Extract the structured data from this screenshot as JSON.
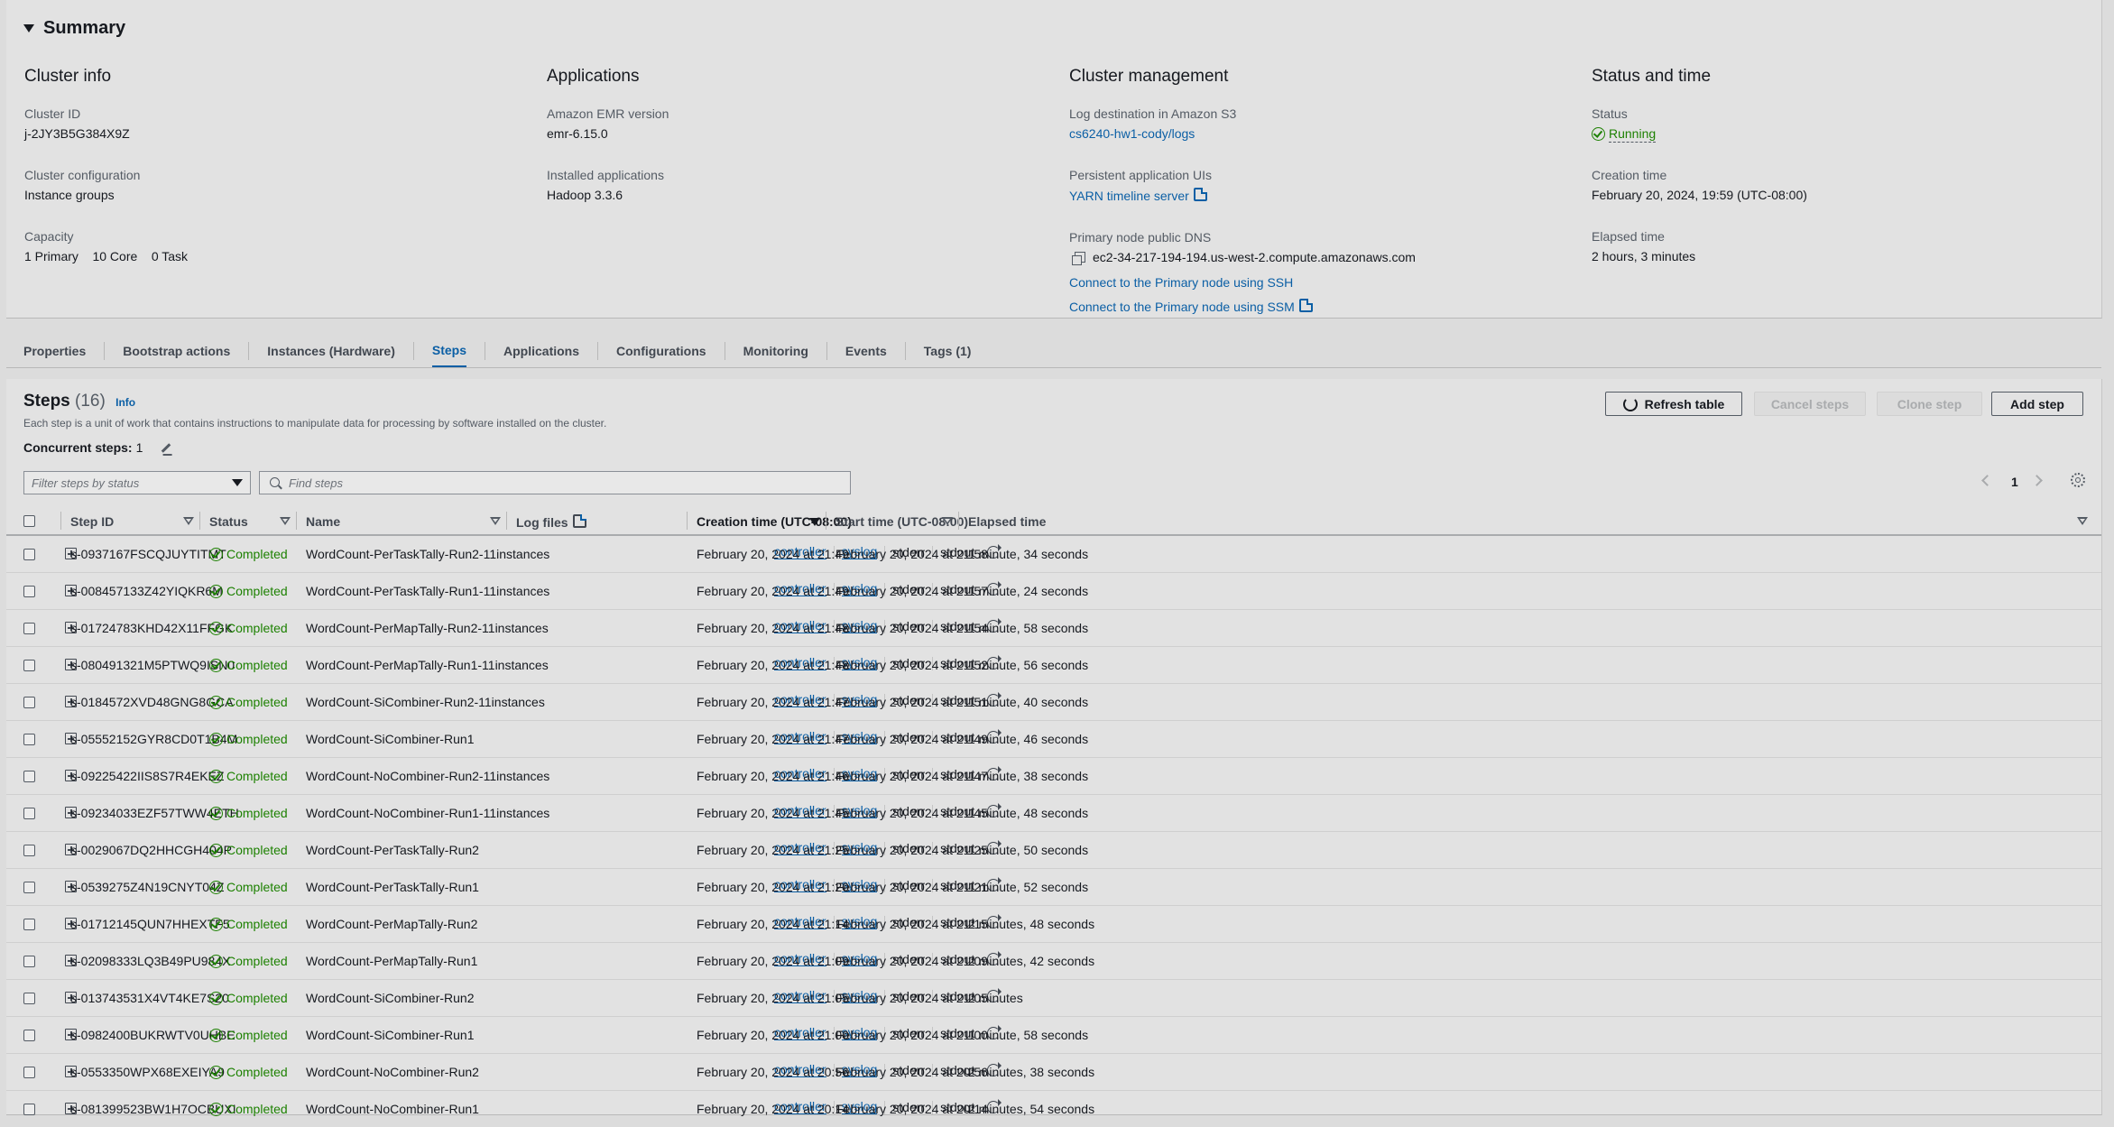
{
  "summary": {
    "title": "Summary",
    "cluster_info": {
      "heading": "Cluster info",
      "cluster_id_label": "Cluster ID",
      "cluster_id": "j-2JY3B5G384X9Z",
      "config_label": "Cluster configuration",
      "config": "Instance groups",
      "capacity_label": "Capacity",
      "capacity_primary": "1 Primary",
      "capacity_core": "10 Core",
      "capacity_task": "0 Task"
    },
    "applications": {
      "heading": "Applications",
      "emr_label": "Amazon EMR version",
      "emr": "emr-6.15.0",
      "installed_label": "Installed applications",
      "installed": "Hadoop 3.3.6"
    },
    "cluster_management": {
      "heading": "Cluster management",
      "log_label": "Log destination in Amazon S3",
      "log": "cs6240-hw1-cody/logs",
      "ui_label": "Persistent application UIs",
      "ui_link": "YARN timeline server",
      "dns_label": "Primary node public DNS",
      "dns": "ec2-34-217-194-194.us-west-2.compute.amazonaws.com",
      "ssh_link": "Connect to the Primary node using SSH",
      "ssm_link": "Connect to the Primary node using SSM"
    },
    "status_time": {
      "heading": "Status and time",
      "status_label": "Status",
      "status": "Running",
      "creation_label": "Creation time",
      "creation": "February 20, 2024, 19:59 (UTC-08:00)",
      "elapsed_label": "Elapsed time",
      "elapsed": "2 hours, 3 minutes"
    }
  },
  "tabs": [
    "Properties",
    "Bootstrap actions",
    "Instances (Hardware)",
    "Steps",
    "Applications",
    "Configurations",
    "Monitoring",
    "Events",
    "Tags (1)"
  ],
  "active_tab": "Steps",
  "steps": {
    "title": "Steps",
    "count": "(16)",
    "info": "Info",
    "description": "Each step is a unit of work that contains instructions to manipulate data for processing by software installed on the cluster.",
    "concurrent_label": "Concurrent steps:",
    "concurrent_value": "1",
    "buttons": {
      "refresh": "Refresh table",
      "cancel": "Cancel steps",
      "clone": "Clone step",
      "add": "Add step"
    },
    "filter_placeholder": "Filter steps by status",
    "search_placeholder": "Find steps",
    "page": "1",
    "columns": {
      "step_id": "Step ID",
      "status": "Status",
      "name": "Name",
      "log_files": "Log files",
      "creation": "Creation time (UTC-08:00)",
      "start": "Start time (UTC-08:00)",
      "elapsed": "Elapsed time"
    },
    "log_labels": [
      "controller",
      "syslog",
      "stderr",
      "stdout"
    ],
    "rows": [
      {
        "id": "s-0937167FSCQJUYTITMT",
        "status": "Completed",
        "name": "WordCount-PerTaskTally-Run2-11instances",
        "creation": "February 20, 2024 at 21:49",
        "start": "February 20, 2024 at 21:58",
        "elapsed": "1 minute, 34 seconds"
      },
      {
        "id": "s-008457133Z42YIQKR6M",
        "status": "Completed",
        "name": "WordCount-PerTaskTally-Run1-11instances",
        "creation": "February 20, 2024 at 21:49",
        "start": "February 20, 2024 at 21:57",
        "elapsed": "1 minute, 24 seconds"
      },
      {
        "id": "s-01724783KHD42X11FFGK",
        "status": "Completed",
        "name": "WordCount-PerMapTally-Run2-11instances",
        "creation": "February 20, 2024 at 21:48",
        "start": "February 20, 2024 at 21:54",
        "elapsed": "1 minute, 58 seconds"
      },
      {
        "id": "s-080491321M5PTWQ9ISN0",
        "status": "Completed",
        "name": "WordCount-PerMapTally-Run1-11instances",
        "creation": "February 20, 2024 at 21:48",
        "start": "February 20, 2024 at 21:52",
        "elapsed": "1 minute, 56 seconds"
      },
      {
        "id": "s-0184572XVD48GNG8GCA",
        "status": "Completed",
        "name": "WordCount-SiCombiner-Run2-11instances",
        "creation": "February 20, 2024 at 21:47",
        "start": "February 20, 2024 at 21:51",
        "elapsed": "1 minute, 40 seconds"
      },
      {
        "id": "s-05552152GYR8CD0T1B4M",
        "status": "Completed",
        "name": "WordCount-SiCombiner-Run1",
        "creation": "February 20, 2024 at 21:47",
        "start": "February 20, 2024 at 21:49",
        "elapsed": "1 minute, 46 seconds"
      },
      {
        "id": "s-09225422IIS8S7R4EKEZ",
        "status": "Completed",
        "name": "WordCount-NoCombiner-Run2-11instances",
        "creation": "February 20, 2024 at 21:46",
        "start": "February 20, 2024 at 21:47",
        "elapsed": "1 minute, 38 seconds"
      },
      {
        "id": "s-09234033EZF57TWW4ETH",
        "status": "Completed",
        "name": "WordCount-NoCombiner-Run1-11instances",
        "creation": "February 20, 2024 at 21:45",
        "start": "February 20, 2024 at 21:45",
        "elapsed": "1 minute, 48 seconds"
      },
      {
        "id": "s-0029067DQ2HHCGH404P",
        "status": "Completed",
        "name": "WordCount-PerTaskTally-Run2",
        "creation": "February 20, 2024 at 21:25",
        "start": "February 20, 2024 at 21:25",
        "elapsed": "1 minute, 50 seconds"
      },
      {
        "id": "s-0539275Z4N19CNYT04Z",
        "status": "Completed",
        "name": "WordCount-PerTaskTally-Run1",
        "creation": "February 20, 2024 at 21:20",
        "start": "February 20, 2024 at 21:21",
        "elapsed": "1 minute, 52 seconds"
      },
      {
        "id": "s-01712145QUN7HHEXTF5",
        "status": "Completed",
        "name": "WordCount-PerMapTally-Run2",
        "creation": "February 20, 2024 at 21:14",
        "start": "February 20, 2024 at 21:15",
        "elapsed": "2 minutes, 48 seconds"
      },
      {
        "id": "s-02098333LQ3B49PU984X",
        "status": "Completed",
        "name": "WordCount-PerMapTally-Run1",
        "creation": "February 20, 2024 at 21:09",
        "start": "February 20, 2024 at 21:09",
        "elapsed": "2 minutes, 42 seconds"
      },
      {
        "id": "s-013743531X4VT4KE7S20",
        "status": "Completed",
        "name": "WordCount-SiCombiner-Run2",
        "creation": "February 20, 2024 at 21:05",
        "start": "February 20, 2024 at 21:05",
        "elapsed": "2 minutes"
      },
      {
        "id": "s-0982400BUKRWTV0UHBE",
        "status": "Completed",
        "name": "WordCount-SiCombiner-Run1",
        "creation": "February 20, 2024 at 21:00",
        "start": "February 20, 2024 at 21:00",
        "elapsed": "1 minute, 58 seconds"
      },
      {
        "id": "s-0553350WPX68EXEIYA9",
        "status": "Completed",
        "name": "WordCount-NoCombiner-Run2",
        "creation": "February 20, 2024 at 20:56",
        "start": "February 20, 2024 at 20:56",
        "elapsed": "2 minutes, 38 seconds"
      },
      {
        "id": "s-081399523BW1H7OCBUXI",
        "status": "Completed",
        "name": "WordCount-NoCombiner-Run1",
        "creation": "February 20, 2024 at 20:14",
        "start": "February 20, 2024 at 20:14",
        "elapsed": "2 minutes, 54 seconds"
      }
    ]
  },
  "colors": {
    "link": "#0b5fa5",
    "success": "#1d8102",
    "background": "#dcdcdc"
  }
}
